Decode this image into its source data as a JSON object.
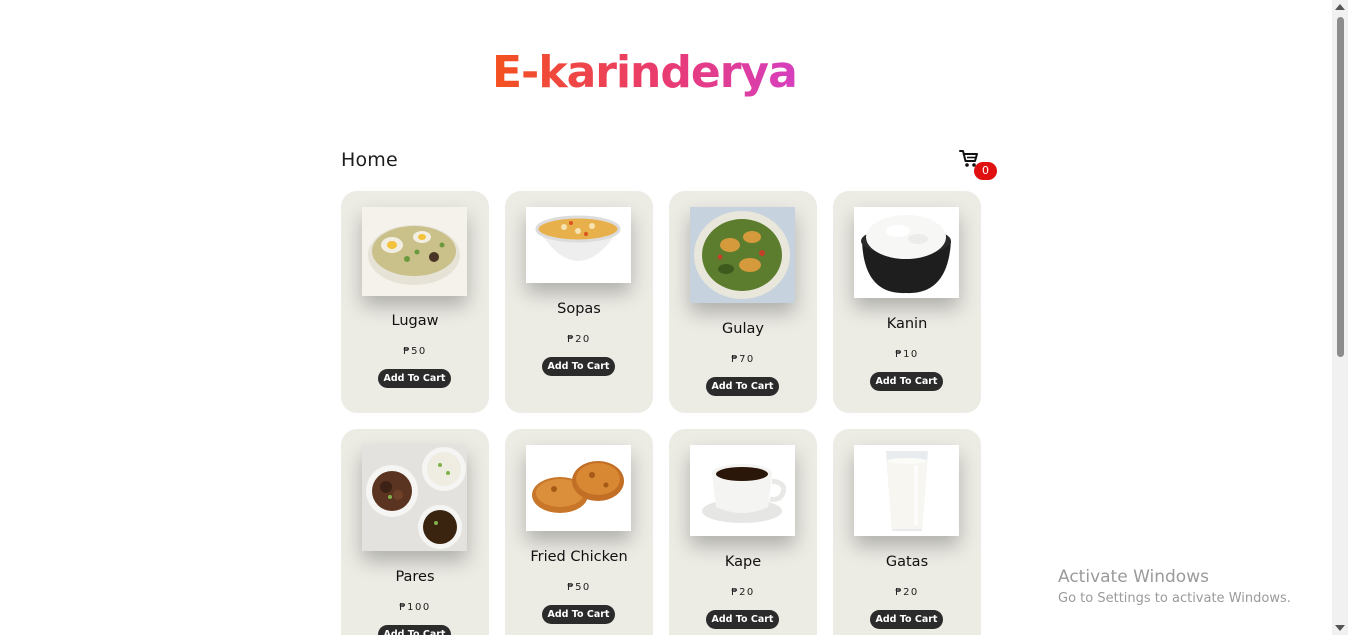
{
  "app": {
    "logo_text": "E-karinderya",
    "page_title": "Home",
    "cart_count": "0",
    "brand_colors": {
      "logo_start": "#f4511e",
      "logo_end": "#d63fbf",
      "card_bg": "#ecebe4",
      "button_bg": "#2b2b2b",
      "badge_bg": "#e01010"
    }
  },
  "products": [
    {
      "name": "Lugaw",
      "price": "₱50",
      "button": "Add To Cart",
      "icon": "lugaw-image"
    },
    {
      "name": "Sopas",
      "price": "₱20",
      "button": "Add To Cart",
      "icon": "sopas-image"
    },
    {
      "name": "Gulay",
      "price": "₱70",
      "button": "Add To Cart",
      "icon": "gulay-image"
    },
    {
      "name": "Kanin",
      "price": "₱10",
      "button": "Add To Cart",
      "icon": "kanin-image"
    },
    {
      "name": "Pares",
      "price": "₱100",
      "button": "Add To Cart",
      "icon": "pares-image"
    },
    {
      "name": "Fried Chicken",
      "price": "₱50",
      "button": "Add To Cart",
      "icon": "fried-chicken-image"
    },
    {
      "name": "Kape",
      "price": "₱20",
      "button": "Add To Cart",
      "icon": "kape-image"
    },
    {
      "name": "Gatas",
      "price": "₱20",
      "button": "Add To Cart",
      "icon": "gatas-image"
    }
  ],
  "overlay": {
    "activate_title": "Activate Windows",
    "activate_subtitle": "Go to Settings to activate Windows."
  }
}
